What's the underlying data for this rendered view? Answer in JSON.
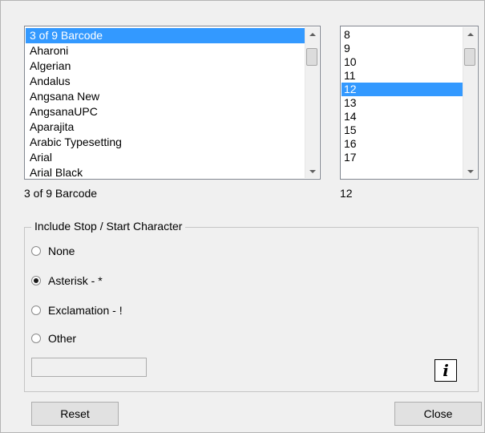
{
  "font_list": {
    "items": [
      "3 of 9 Barcode",
      "Aharoni",
      "Algerian",
      "Andalus",
      "Angsana New",
      "AngsanaUPC",
      "Aparajita",
      "Arabic Typesetting",
      "Arial",
      "Arial Black"
    ],
    "selected_index": 0,
    "selected_value": "3 of 9 Barcode"
  },
  "size_list": {
    "items": [
      "8",
      "9",
      "10",
      "11",
      "12",
      "13",
      "14",
      "15",
      "16",
      "17"
    ],
    "selected_index": 4,
    "selected_value": "12"
  },
  "stop_start": {
    "title": "Include Stop / Start Character",
    "options": [
      {
        "label": "None",
        "checked": false
      },
      {
        "label": "Asterisk - *",
        "checked": true
      },
      {
        "label": "Exclamation - !",
        "checked": false
      },
      {
        "label": "Other",
        "checked": false
      }
    ],
    "other_value": ""
  },
  "info_button": {
    "glyph": "i",
    "icon": "info-icon"
  },
  "buttons": {
    "reset": "Reset",
    "close": "Close"
  },
  "colors": {
    "selection": "#3399ff",
    "dialog_bg": "#f0f0f0"
  }
}
